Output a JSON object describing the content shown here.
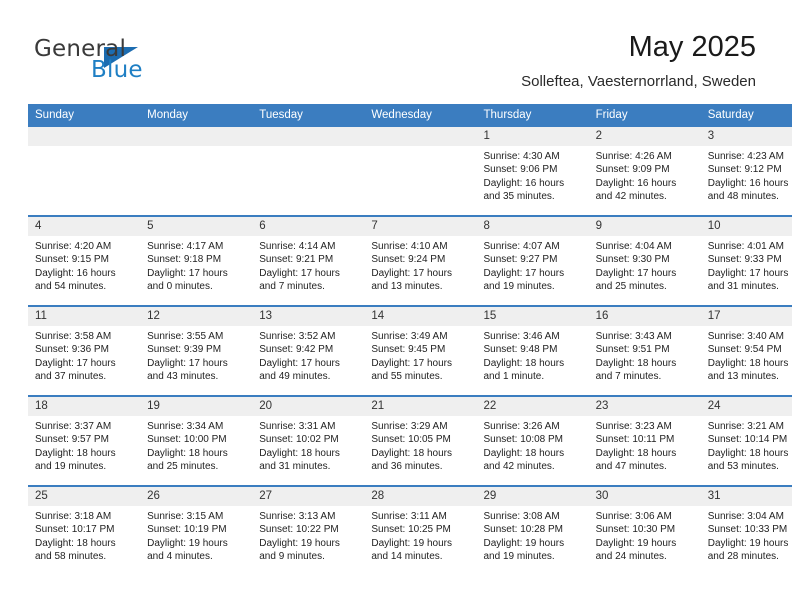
{
  "brand": {
    "word_one": "General",
    "word_two": "Blue",
    "logo_icon": "blue-triangle-logo"
  },
  "header": {
    "title": "May 2025",
    "subtitle": "Solleftea, Vaesternorrland, Sweden"
  },
  "calendar": {
    "weekday_headers": [
      "Sunday",
      "Monday",
      "Tuesday",
      "Wednesday",
      "Thursday",
      "Friday",
      "Saturday"
    ],
    "accent_color": "#3b7dc0",
    "daynum_band_color": "#efefef",
    "weeks": [
      [
        {
          "day": "",
          "empty": true
        },
        {
          "day": "",
          "empty": true
        },
        {
          "day": "",
          "empty": true
        },
        {
          "day": "",
          "empty": true
        },
        {
          "day": "1",
          "sunrise": "Sunrise: 4:30 AM",
          "sunset": "Sunset: 9:06 PM",
          "daylight_line1": "Daylight: 16 hours",
          "daylight_line2": "and 35 minutes."
        },
        {
          "day": "2",
          "sunrise": "Sunrise: 4:26 AM",
          "sunset": "Sunset: 9:09 PM",
          "daylight_line1": "Daylight: 16 hours",
          "daylight_line2": "and 42 minutes."
        },
        {
          "day": "3",
          "sunrise": "Sunrise: 4:23 AM",
          "sunset": "Sunset: 9:12 PM",
          "daylight_line1": "Daylight: 16 hours",
          "daylight_line2": "and 48 minutes."
        }
      ],
      [
        {
          "day": "4",
          "sunrise": "Sunrise: 4:20 AM",
          "sunset": "Sunset: 9:15 PM",
          "daylight_line1": "Daylight: 16 hours",
          "daylight_line2": "and 54 minutes."
        },
        {
          "day": "5",
          "sunrise": "Sunrise: 4:17 AM",
          "sunset": "Sunset: 9:18 PM",
          "daylight_line1": "Daylight: 17 hours",
          "daylight_line2": "and 0 minutes."
        },
        {
          "day": "6",
          "sunrise": "Sunrise: 4:14 AM",
          "sunset": "Sunset: 9:21 PM",
          "daylight_line1": "Daylight: 17 hours",
          "daylight_line2": "and 7 minutes."
        },
        {
          "day": "7",
          "sunrise": "Sunrise: 4:10 AM",
          "sunset": "Sunset: 9:24 PM",
          "daylight_line1": "Daylight: 17 hours",
          "daylight_line2": "and 13 minutes."
        },
        {
          "day": "8",
          "sunrise": "Sunrise: 4:07 AM",
          "sunset": "Sunset: 9:27 PM",
          "daylight_line1": "Daylight: 17 hours",
          "daylight_line2": "and 19 minutes."
        },
        {
          "day": "9",
          "sunrise": "Sunrise: 4:04 AM",
          "sunset": "Sunset: 9:30 PM",
          "daylight_line1": "Daylight: 17 hours",
          "daylight_line2": "and 25 minutes."
        },
        {
          "day": "10",
          "sunrise": "Sunrise: 4:01 AM",
          "sunset": "Sunset: 9:33 PM",
          "daylight_line1": "Daylight: 17 hours",
          "daylight_line2": "and 31 minutes."
        }
      ],
      [
        {
          "day": "11",
          "sunrise": "Sunrise: 3:58 AM",
          "sunset": "Sunset: 9:36 PM",
          "daylight_line1": "Daylight: 17 hours",
          "daylight_line2": "and 37 minutes."
        },
        {
          "day": "12",
          "sunrise": "Sunrise: 3:55 AM",
          "sunset": "Sunset: 9:39 PM",
          "daylight_line1": "Daylight: 17 hours",
          "daylight_line2": "and 43 minutes."
        },
        {
          "day": "13",
          "sunrise": "Sunrise: 3:52 AM",
          "sunset": "Sunset: 9:42 PM",
          "daylight_line1": "Daylight: 17 hours",
          "daylight_line2": "and 49 minutes."
        },
        {
          "day": "14",
          "sunrise": "Sunrise: 3:49 AM",
          "sunset": "Sunset: 9:45 PM",
          "daylight_line1": "Daylight: 17 hours",
          "daylight_line2": "and 55 minutes."
        },
        {
          "day": "15",
          "sunrise": "Sunrise: 3:46 AM",
          "sunset": "Sunset: 9:48 PM",
          "daylight_line1": "Daylight: 18 hours",
          "daylight_line2": "and 1 minute."
        },
        {
          "day": "16",
          "sunrise": "Sunrise: 3:43 AM",
          "sunset": "Sunset: 9:51 PM",
          "daylight_line1": "Daylight: 18 hours",
          "daylight_line2": "and 7 minutes."
        },
        {
          "day": "17",
          "sunrise": "Sunrise: 3:40 AM",
          "sunset": "Sunset: 9:54 PM",
          "daylight_line1": "Daylight: 18 hours",
          "daylight_line2": "and 13 minutes."
        }
      ],
      [
        {
          "day": "18",
          "sunrise": "Sunrise: 3:37 AM",
          "sunset": "Sunset: 9:57 PM",
          "daylight_line1": "Daylight: 18 hours",
          "daylight_line2": "and 19 minutes."
        },
        {
          "day": "19",
          "sunrise": "Sunrise: 3:34 AM",
          "sunset": "Sunset: 10:00 PM",
          "daylight_line1": "Daylight: 18 hours",
          "daylight_line2": "and 25 minutes."
        },
        {
          "day": "20",
          "sunrise": "Sunrise: 3:31 AM",
          "sunset": "Sunset: 10:02 PM",
          "daylight_line1": "Daylight: 18 hours",
          "daylight_line2": "and 31 minutes."
        },
        {
          "day": "21",
          "sunrise": "Sunrise: 3:29 AM",
          "sunset": "Sunset: 10:05 PM",
          "daylight_line1": "Daylight: 18 hours",
          "daylight_line2": "and 36 minutes."
        },
        {
          "day": "22",
          "sunrise": "Sunrise: 3:26 AM",
          "sunset": "Sunset: 10:08 PM",
          "daylight_line1": "Daylight: 18 hours",
          "daylight_line2": "and 42 minutes."
        },
        {
          "day": "23",
          "sunrise": "Sunrise: 3:23 AM",
          "sunset": "Sunset: 10:11 PM",
          "daylight_line1": "Daylight: 18 hours",
          "daylight_line2": "and 47 minutes."
        },
        {
          "day": "24",
          "sunrise": "Sunrise: 3:21 AM",
          "sunset": "Sunset: 10:14 PM",
          "daylight_line1": "Daylight: 18 hours",
          "daylight_line2": "and 53 minutes."
        }
      ],
      [
        {
          "day": "25",
          "sunrise": "Sunrise: 3:18 AM",
          "sunset": "Sunset: 10:17 PM",
          "daylight_line1": "Daylight: 18 hours",
          "daylight_line2": "and 58 minutes."
        },
        {
          "day": "26",
          "sunrise": "Sunrise: 3:15 AM",
          "sunset": "Sunset: 10:19 PM",
          "daylight_line1": "Daylight: 19 hours",
          "daylight_line2": "and 4 minutes."
        },
        {
          "day": "27",
          "sunrise": "Sunrise: 3:13 AM",
          "sunset": "Sunset: 10:22 PM",
          "daylight_line1": "Daylight: 19 hours",
          "daylight_line2": "and 9 minutes."
        },
        {
          "day": "28",
          "sunrise": "Sunrise: 3:11 AM",
          "sunset": "Sunset: 10:25 PM",
          "daylight_line1": "Daylight: 19 hours",
          "daylight_line2": "and 14 minutes."
        },
        {
          "day": "29",
          "sunrise": "Sunrise: 3:08 AM",
          "sunset": "Sunset: 10:28 PM",
          "daylight_line1": "Daylight: 19 hours",
          "daylight_line2": "and 19 minutes."
        },
        {
          "day": "30",
          "sunrise": "Sunrise: 3:06 AM",
          "sunset": "Sunset: 10:30 PM",
          "daylight_line1": "Daylight: 19 hours",
          "daylight_line2": "and 24 minutes."
        },
        {
          "day": "31",
          "sunrise": "Sunrise: 3:04 AM",
          "sunset": "Sunset: 10:33 PM",
          "daylight_line1": "Daylight: 19 hours",
          "daylight_line2": "and 28 minutes."
        }
      ]
    ]
  }
}
